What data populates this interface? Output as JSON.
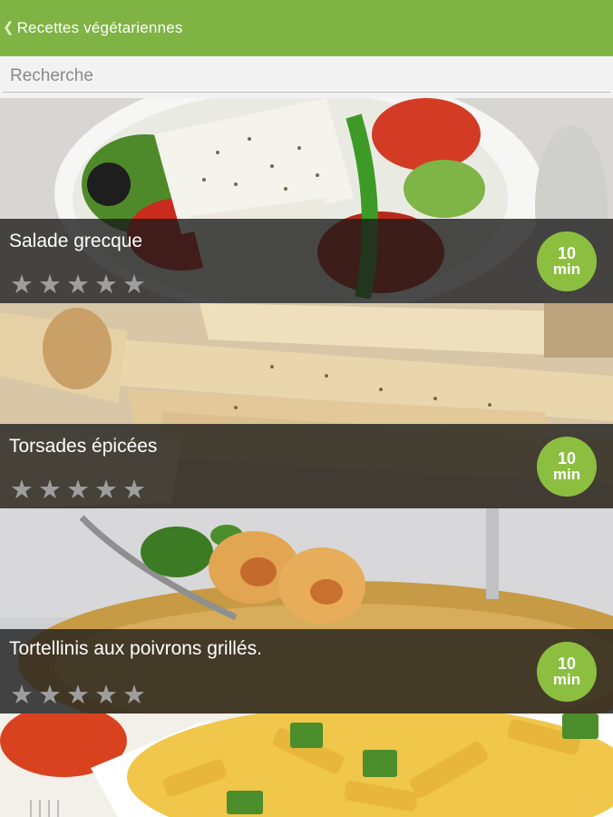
{
  "header": {
    "back_icon": "chevron-left-icon",
    "title": "Recettes végétariennes"
  },
  "search": {
    "placeholder": "Recherche",
    "value": ""
  },
  "recipes": [
    {
      "name": "Salade grecque",
      "time_value": "10",
      "time_unit": "min",
      "rating": 0,
      "rating_max": 5
    },
    {
      "name": "Torsades épicées",
      "time_value": "10",
      "time_unit": "min",
      "rating": 0,
      "rating_max": 5
    },
    {
      "name": "Tortellinis aux poivrons grillés.",
      "time_value": "10",
      "time_unit": "min",
      "rating": 0,
      "rating_max": 5
    },
    {
      "name": "",
      "time_value": "",
      "time_unit": "",
      "rating": 0,
      "rating_max": 5
    }
  ],
  "colors": {
    "accent": "#7fb444",
    "badge": "#8cbe3f",
    "star_empty": "#9e9e9e"
  }
}
